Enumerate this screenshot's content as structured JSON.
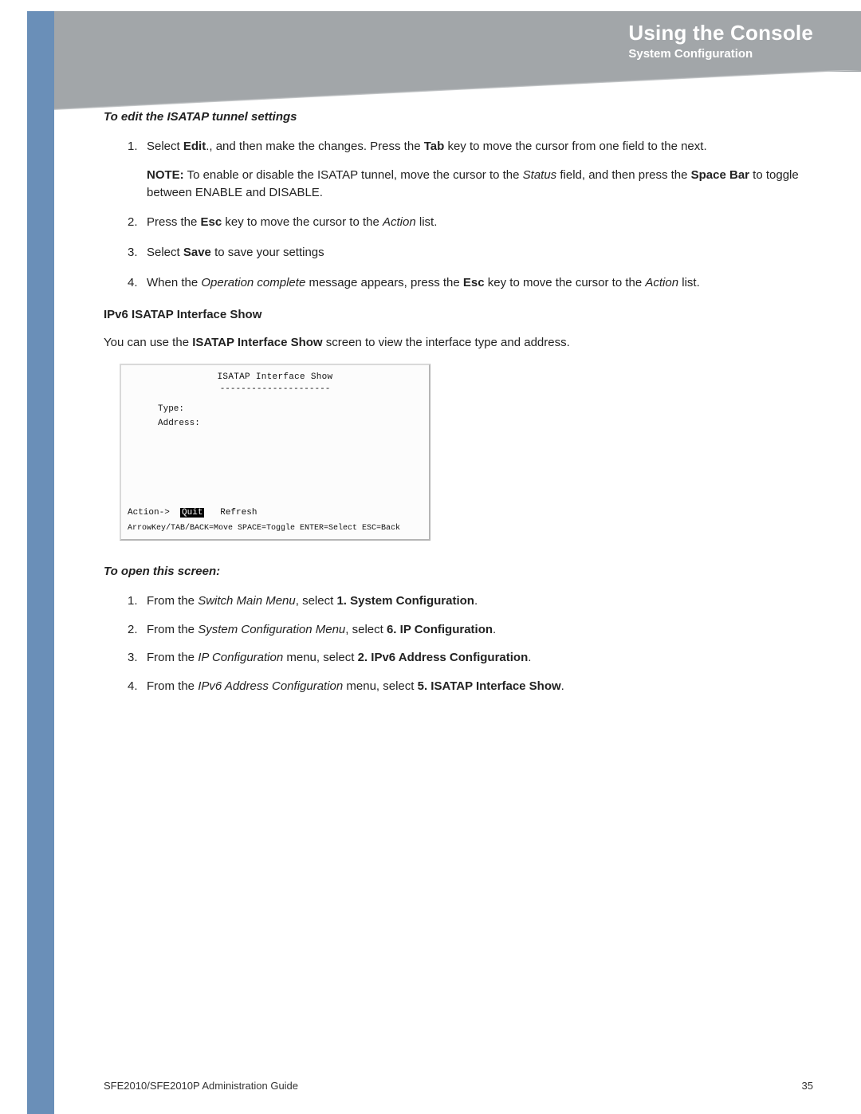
{
  "header": {
    "chapter": "Using the Console",
    "section": "System Configuration"
  },
  "edit_heading": "To edit the ISATAP tunnel settings",
  "steps1": {
    "s1_a": "Select ",
    "s1_bold": "Edit",
    "s1_b": "., and then make the changes. Press the ",
    "s1_bold2": "Tab",
    "s1_c": " key to move the cursor from one field to the next.",
    "note_label": "NOTE:",
    "note_a": " To enable or disable the ISATAP tunnel, move the cursor to the ",
    "note_ital": "Status",
    "note_b": " field, and then press the ",
    "note_bold": "Space Bar",
    "note_c": " to toggle between ENABLE and DISABLE.",
    "s2_a": "Press the ",
    "s2_bold": "Esc",
    "s2_b": " key to move the cursor to the ",
    "s2_ital": "Action",
    "s2_c": " list.",
    "s3_a": "Select ",
    "s3_bold": "Save",
    "s3_b": " to save your settings",
    "s4_a": "When the ",
    "s4_ital": "Operation complete",
    "s4_b": " message appears, press the ",
    "s4_bold": "Esc",
    "s4_c": " key to move the cursor to the ",
    "s4_ital2": "Action",
    "s4_d": " list."
  },
  "ipv6_heading": "IPv6 ISATAP Interface Show",
  "ipv6_para_a": "You can use the ",
  "ipv6_para_bold": "ISATAP Interface Show",
  "ipv6_para_b": " screen to view the interface type and address.",
  "terminal": {
    "title": "ISATAP Interface Show",
    "underline": "---------------------",
    "type": "Type:",
    "address": "Address:",
    "action_label": "Action->",
    "quit": "Quit",
    "refresh": "Refresh",
    "footer": "ArrowKey/TAB/BACK=Move  SPACE=Toggle  ENTER=Select  ESC=Back"
  },
  "open_heading": "To open this screen:",
  "steps2": {
    "s1_a": "From the ",
    "s1_ital": "Switch Main Menu",
    "s1_b": ", select ",
    "s1_bold": "1. System Configuration",
    "s1_c": ".",
    "s2_a": "From the ",
    "s2_ital": "System Configuration Menu",
    "s2_b": ", select ",
    "s2_bold": "6. IP Configuration",
    "s2_c": ".",
    "s3_a": "From the ",
    "s3_ital": "IP Configuration",
    "s3_b": " menu, select ",
    "s3_bold": "2. IPv6 Address Configuration",
    "s3_c": ".",
    "s4_a": "From the ",
    "s4_ital": "IPv6 Address Configuration",
    "s4_b": " menu, select ",
    "s4_bold": "5. ISATAP Interface Show",
    "s4_c": "."
  },
  "footer": {
    "doc": "SFE2010/SFE2010P Administration Guide",
    "page": "35"
  }
}
